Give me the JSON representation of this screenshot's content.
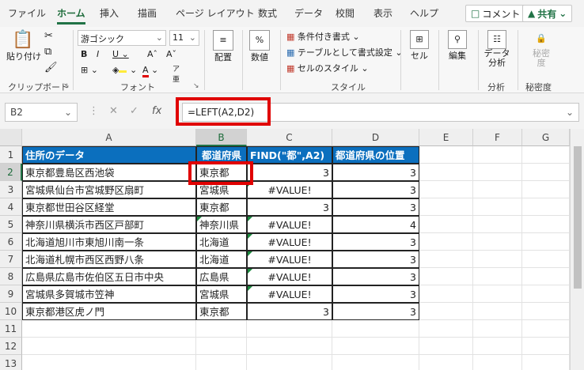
{
  "tabs": [
    "ファイル",
    "ホーム",
    "挿入",
    "描画",
    "ページ レイアウト",
    "数式",
    "データ",
    "校閲",
    "表示",
    "ヘルプ"
  ],
  "buttons": {
    "comment": "コメント",
    "share": "共有"
  },
  "ribbon": {
    "paste": "貼り付け",
    "clipboard_group": "クリップボード",
    "font_name": "游ゴシック",
    "font_size": "11",
    "font_group": "フォント",
    "align": "配置",
    "number": "数値",
    "cond_format": "条件付き書式",
    "table_format": "テーブルとして書式設定",
    "cell_style": "セルのスタイル",
    "style_group": "スタイル",
    "cells": "セル",
    "edit": "編集",
    "data_analysis_1": "データ",
    "data_analysis_2": "分析",
    "analysis_group": "分析",
    "sensitivity_1": "秘密",
    "sensitivity_2": "度",
    "sensitivity_group": "秘密度"
  },
  "formula_bar": {
    "name_box": "B2",
    "formula": "=LEFT(A2,D2)"
  },
  "columns": [
    "A",
    "B",
    "C",
    "D",
    "E",
    "F",
    "G"
  ],
  "rows": [
    "1",
    "2",
    "3",
    "4",
    "5",
    "6",
    "7",
    "8",
    "9",
    "10",
    "11",
    "12",
    "13"
  ],
  "table": {
    "headers": [
      "住所のデータ",
      "都道府県",
      "FIND(\"都\",A2)",
      "都道府県の位置"
    ],
    "data": [
      [
        "東京都豊島区西池袋",
        "東京都",
        "3",
        "3"
      ],
      [
        "宮城県仙台市宮城野区扇町",
        "宮城県",
        "#VALUE!",
        "3"
      ],
      [
        "東京都世田谷区経堂",
        "東京都",
        "3",
        "3"
      ],
      [
        "神奈川県横浜市西区戸部町",
        "神奈川県",
        "#VALUE!",
        "4"
      ],
      [
        "北海道旭川市東旭川南一条",
        "北海道",
        "#VALUE!",
        "3"
      ],
      [
        "北海道札幌市西区西野八条",
        "北海道",
        "#VALUE!",
        "3"
      ],
      [
        "広島県広島市佐伯区五日市中央",
        "広島県",
        "#VALUE!",
        "3"
      ],
      [
        "宮城県多賀城市笠神",
        "宮城県",
        "#VALUE!",
        "3"
      ],
      [
        "東京都港区虎ノ門",
        "東京都",
        "3",
        "3"
      ]
    ]
  },
  "colors": {
    "accent": "#217346",
    "header_fill": "#0b6fbe",
    "highlight": "#e00000"
  }
}
